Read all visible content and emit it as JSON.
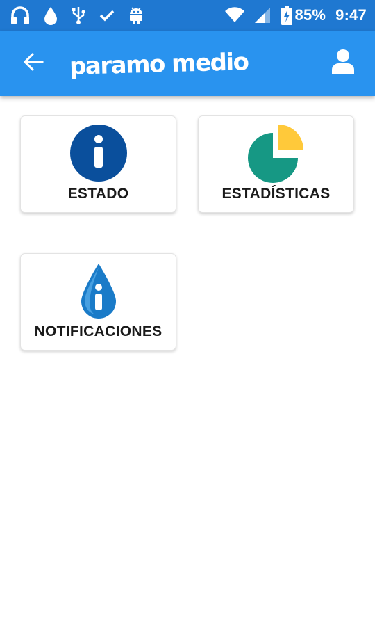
{
  "status_bar": {
    "battery": "85%",
    "time": "9:47",
    "left_icons": [
      "headphones-icon",
      "water-drop-icon",
      "usb-icon",
      "check-icon",
      "android-icon"
    ],
    "right_icons": [
      "wifi-icon",
      "signal-icon",
      "battery-charging-icon"
    ]
  },
  "app_bar": {
    "title": "paramo medio",
    "back_icon": "arrow-back-icon",
    "profile_icon": "person-icon"
  },
  "menu": {
    "items": [
      {
        "label": "ESTADO",
        "icon": "info-circle-icon"
      },
      {
        "label": "ESTADÍSTICAS",
        "icon": "pie-chart-icon"
      },
      {
        "label": "NOTIFICACIONES",
        "icon": "water-drop-info-icon"
      }
    ]
  },
  "colors": {
    "status_bar": "#1f78d1",
    "app_bar": "#2993ef",
    "info_blue": "#0a4f9c",
    "pie_green": "#169884",
    "pie_yellow": "#ffc93a",
    "drop_blue": "#1a7bc8"
  }
}
